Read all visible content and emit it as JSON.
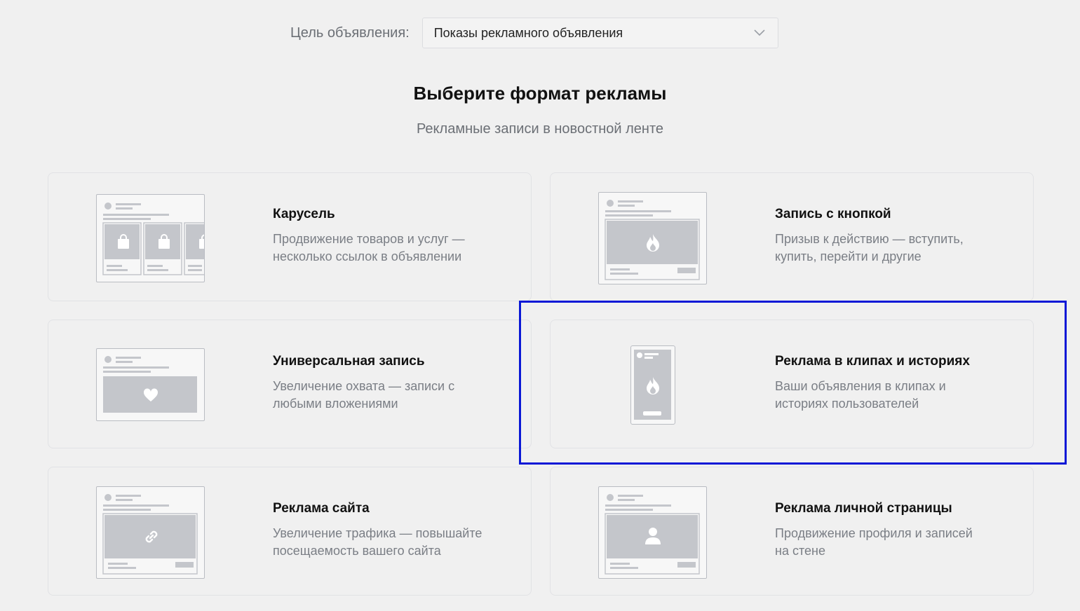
{
  "goal": {
    "label": "Цель объявления:",
    "selected": "Показы рекламного объявления"
  },
  "heading": {
    "title": "Выберите формат рекламы",
    "subtitle": "Рекламные записи в новостной ленте"
  },
  "formats": [
    {
      "title": "Карусель",
      "desc_line1": "Продвижение товаров и услуг —",
      "desc_line2": "несколько ссылок в объявлении",
      "icon": "shopping-bag-icon"
    },
    {
      "title": "Запись с кнопкой",
      "desc_line1": "Призыв к действию — вступить,",
      "desc_line2": "купить, перейти и другие",
      "icon": "fire-icon"
    },
    {
      "title": "Универсальная запись",
      "desc_line1": "Увеличение охвата — записи с",
      "desc_line2": "любыми вложениями",
      "icon": "heart-icon"
    },
    {
      "title": "Реклама в клипах и историях",
      "desc_line1": "Ваши объявления в клипах и",
      "desc_line2": "историях пользователей",
      "icon": "fire-icon",
      "highlighted": true
    },
    {
      "title": "Реклама сайта",
      "desc_line1": "Увеличение трафика — повышайте",
      "desc_line2": "посещаемость вашего сайта",
      "icon": "link-icon"
    },
    {
      "title": "Реклама личной страницы",
      "desc_line1": "Продвижение профиля и записей",
      "desc_line2": "на стене",
      "icon": "person-icon"
    }
  ],
  "colors": {
    "background": "#f0f0f0",
    "placeholder_gray": "#c4c6cb",
    "highlight_border": "#0a18d6"
  }
}
